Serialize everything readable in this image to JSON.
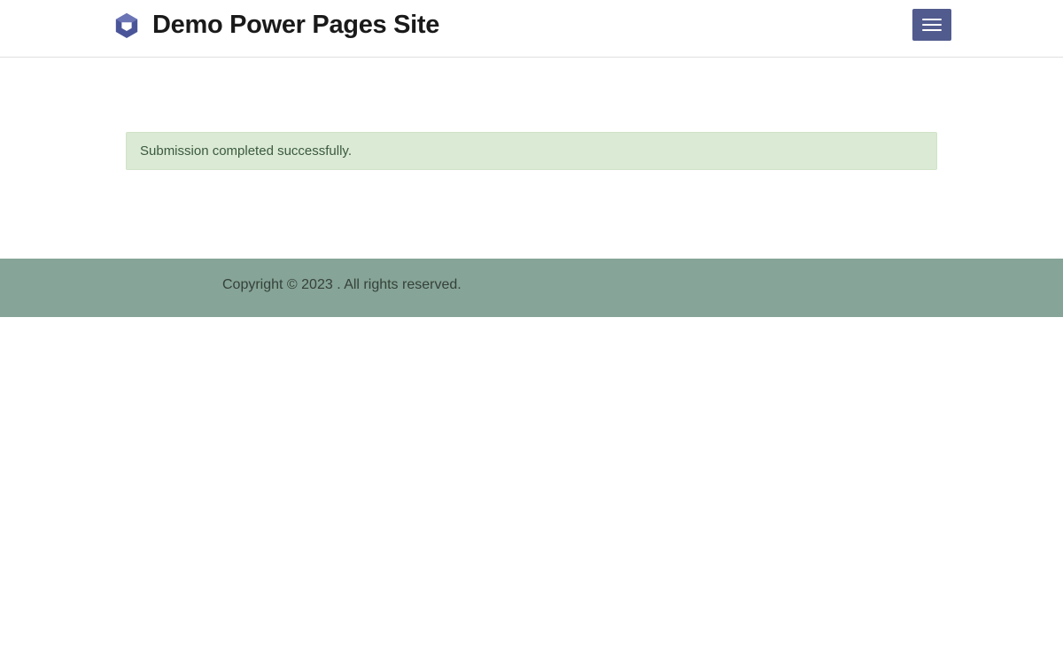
{
  "header": {
    "site_title": "Demo Power Pages Site"
  },
  "main": {
    "alert_message": "Submission completed successfully."
  },
  "footer": {
    "copyright_text": "Copyright © 2023 . All rights reserved."
  }
}
